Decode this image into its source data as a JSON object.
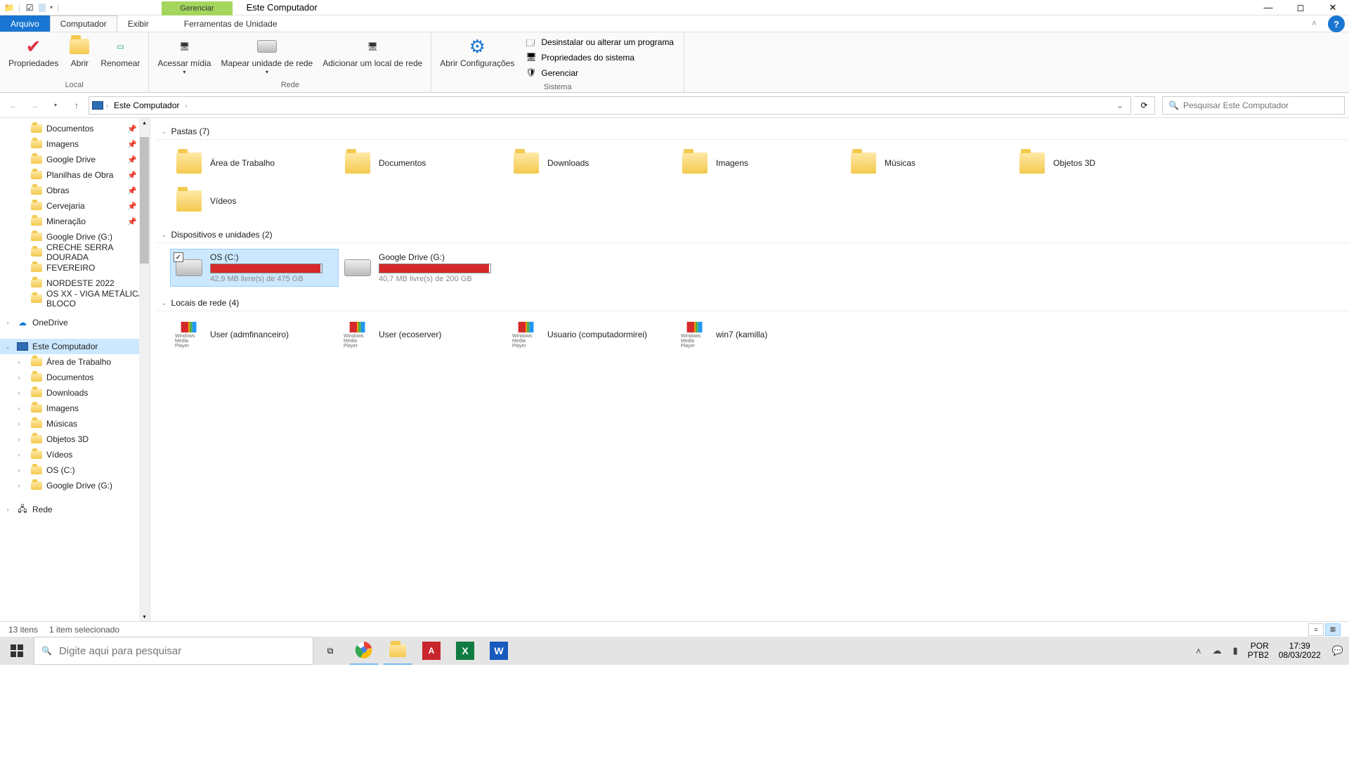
{
  "window": {
    "title": "Este Computador",
    "context_tab": "Gerenciar"
  },
  "menu": {
    "file": "Arquivo",
    "computer": "Computador",
    "view": "Exibir",
    "tools": "Ferramentas de Unidade"
  },
  "ribbon": {
    "g1": {
      "label": "Local",
      "props": "Propriedades",
      "open": "Abrir",
      "rename": "Renomear"
    },
    "g2": {
      "label": "Rede",
      "media": "Acessar mídia",
      "map": "Mapear unidade de rede",
      "addloc": "Adicionar um local de rede"
    },
    "g3": {
      "label": "Sistema",
      "settings": "Abrir Configurações",
      "uninstall": "Desinstalar ou alterar um programa",
      "sysprops": "Propriedades do sistema",
      "manage": "Gerenciar"
    }
  },
  "breadcrumb": {
    "root": "Este Computador"
  },
  "search_placeholder": "Pesquisar Este Computador",
  "sidebar": {
    "quick": [
      {
        "label": "Documentos",
        "pin": true,
        "icon": "doc"
      },
      {
        "label": "Imagens",
        "pin": true,
        "icon": "pic"
      },
      {
        "label": "Google Drive",
        "pin": true,
        "icon": "gd"
      },
      {
        "label": "Planilhas de Obra",
        "pin": true,
        "icon": "xl"
      },
      {
        "label": "Obras",
        "pin": true,
        "icon": "fld"
      },
      {
        "label": "Cervejaria",
        "pin": true,
        "icon": "fld"
      },
      {
        "label": "Mineração",
        "pin": true,
        "icon": "fld"
      },
      {
        "label": "Google Drive (G:)",
        "pin": false,
        "icon": "drv"
      },
      {
        "label": "CRECHE SERRA DOURADA",
        "pin": false,
        "icon": "fld"
      },
      {
        "label": "FEVEREIRO",
        "pin": false,
        "icon": "fld"
      },
      {
        "label": "NORDESTE 2022",
        "pin": false,
        "icon": "fld"
      },
      {
        "label": "OS XX - VIGA METÁLICA BLOCO",
        "pin": false,
        "icon": "fld"
      }
    ],
    "onedrive": "OneDrive",
    "thispc": "Este Computador",
    "pc_children": [
      "Área de Trabalho",
      "Documentos",
      "Downloads",
      "Imagens",
      "Músicas",
      "Objetos 3D",
      "Vídeos",
      "OS (C:)",
      "Google Drive (G:)"
    ],
    "network": "Rede"
  },
  "groups": {
    "folders": {
      "title": "Pastas (7)",
      "items": [
        "Área de Trabalho",
        "Documentos",
        "Downloads",
        "Imagens",
        "Músicas",
        "Objetos 3D",
        "Vídeos"
      ]
    },
    "drives": {
      "title": "Dispositivos e unidades (2)",
      "items": [
        {
          "name": "OS (C:)",
          "sub": "42,9 MB livre(s) de 475 GB",
          "pct": 99,
          "sel": true
        },
        {
          "name": "Google Drive (G:)",
          "sub": "40,7 MB livre(s) de 200 GB",
          "pct": 99,
          "sel": false
        }
      ]
    },
    "network": {
      "title": "Locais de rede (4)",
      "items": [
        "User (admfinanceiro)",
        "User (ecoserver)",
        "Usuario (computadormirei)",
        "win7 (kamilla)"
      ]
    }
  },
  "status": {
    "count": "13 itens",
    "sel": "1 item selecionado"
  },
  "taskbar": {
    "search": "Digite aqui para pesquisar",
    "lang1": "POR",
    "lang2": "PTB2",
    "time": "17:39",
    "date": "08/03/2022"
  }
}
